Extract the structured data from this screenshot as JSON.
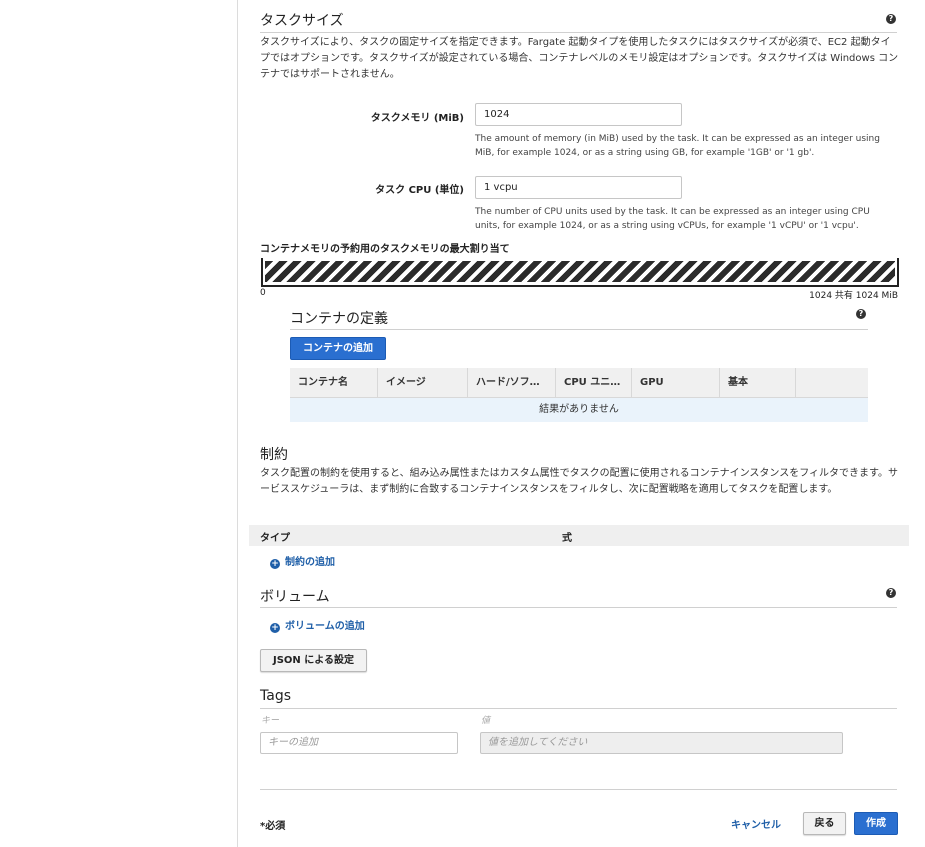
{
  "task_size": {
    "title": "タスクサイズ",
    "help": "?",
    "description": "タスクサイズにより、タスクの固定サイズを指定できます。Fargate 起動タイプを使用したタスクにはタスクサイズが必須で、EC2 起動タイプではオプションです。タスクサイズが設定されている場合、コンテナレベルのメモリ設定はオプションです。タスクサイズは Windows コンテナではサポートされません。",
    "memory_label": "タスクメモリ (MiB)",
    "memory_value": "1024",
    "memory_hint": "The amount of memory (in MiB) used by the task. It can be expressed as an integer using MiB, for example 1024, or as a string using GB, for example '1GB' or '1 gb'.",
    "cpu_label": "タスク CPU (単位)",
    "cpu_value": "1 vcpu",
    "cpu_hint": "The number of CPU units used by the task. It can be expressed as an integer using CPU units, for example 1024, or as a string using vCPUs, for example '1 vCPU' or '1 vcpu'."
  },
  "memory_allocation": {
    "title": "コンテナメモリの予約用のタスクメモリの最大割り当て",
    "min_label": "0",
    "max_label": "1024 共有 1024 MiB",
    "fill_fraction": 1.0
  },
  "container_definitions": {
    "title": "コンテナの定義",
    "help": "?",
    "add_button": "コンテナの追加",
    "columns": [
      "コンテナ名",
      "イメージ",
      "ハード/ソフ…",
      "CPU ユニ…",
      "GPU",
      "基本",
      ""
    ],
    "empty_text": "結果がありません"
  },
  "constraints": {
    "title": "制約",
    "description": "タスク配置の制約を使用すると、組み込み属性またはカスタム属性でタスクの配置に使用されるコンテナインスタンスをフィルタできます。サービススケジューラは、まず制約に合致するコンテナインスタンスをフィルタし、次に配置戦略を適用してタスクを配置します。",
    "col_type": "タイプ",
    "col_expression": "式",
    "add_link": "制約の追加"
  },
  "volumes": {
    "title": "ボリューム",
    "help": "?",
    "add_link": "ボリュームの追加"
  },
  "json_button": "JSON による設定",
  "tags": {
    "title": "Tags",
    "key_label": "キー",
    "value_label": "値",
    "key_placeholder": "キーの追加",
    "value_placeholder": "値を追加してください"
  },
  "footer": {
    "required_note": "*必須",
    "cancel": "キャンセル",
    "back": "戻る",
    "create": "作成"
  },
  "colors": {
    "primary": "#2a6fd0",
    "link": "#1f5fa8",
    "empty_row": "#eaf3fb"
  }
}
